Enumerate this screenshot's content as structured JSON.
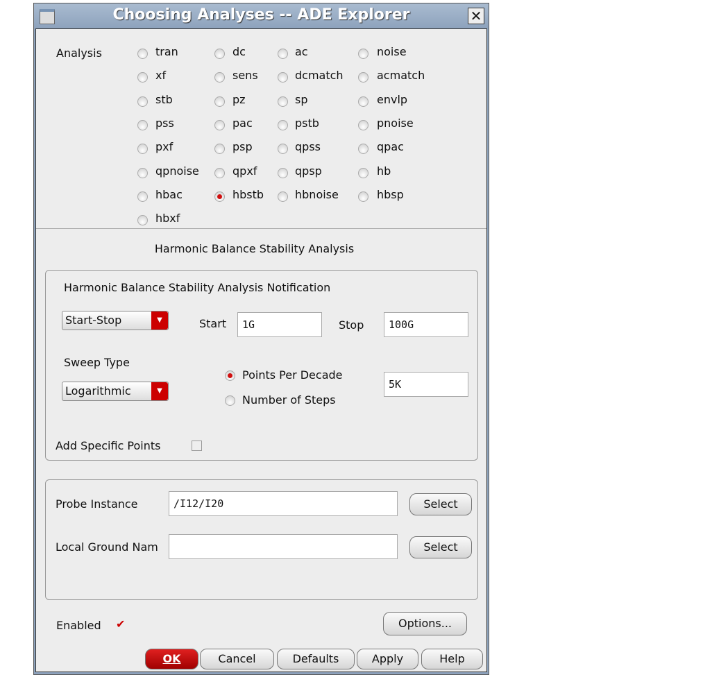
{
  "window": {
    "title": "Choosing Analyses -- ADE Explorer"
  },
  "analysis": {
    "label": "Analysis",
    "selected": "hbstb",
    "options": [
      "tran",
      "dc",
      "ac",
      "noise",
      "xf",
      "sens",
      "dcmatch",
      "acmatch",
      "stb",
      "pz",
      "sp",
      "envlp",
      "pss",
      "pac",
      "pstb",
      "pnoise",
      "pxf",
      "psp",
      "qpss",
      "qpac",
      "qpnoise",
      "qpxf",
      "qpsp",
      "hb",
      "hbac",
      "hbstb",
      "hbnoise",
      "hbsp",
      "hbxf"
    ]
  },
  "section_title": "Harmonic Balance Stability Analysis",
  "sweep": {
    "group_title": "Harmonic Balance Stability Analysis Notification",
    "range_mode": "Start-Stop",
    "start_label": "Start",
    "start_value": "1G",
    "stop_label": "Stop",
    "stop_value": "100G",
    "sweep_type_label": "Sweep Type",
    "sweep_type": "Logarithmic",
    "ppd_label": "Points Per Decade",
    "steps_label": "Number of Steps",
    "points_value": "5K",
    "add_points_label": "Add Specific Points"
  },
  "probe": {
    "probe_label": "Probe Instance",
    "probe_value": "/I12/I20",
    "select_label": "Select",
    "ground_label": "Local Ground Nam",
    "ground_value": ""
  },
  "enabled_label": "Enabled",
  "options_button": "Options...",
  "buttons": {
    "ok": "OK",
    "cancel": "Cancel",
    "defaults": "Defaults",
    "apply": "Apply",
    "help": "Help"
  }
}
